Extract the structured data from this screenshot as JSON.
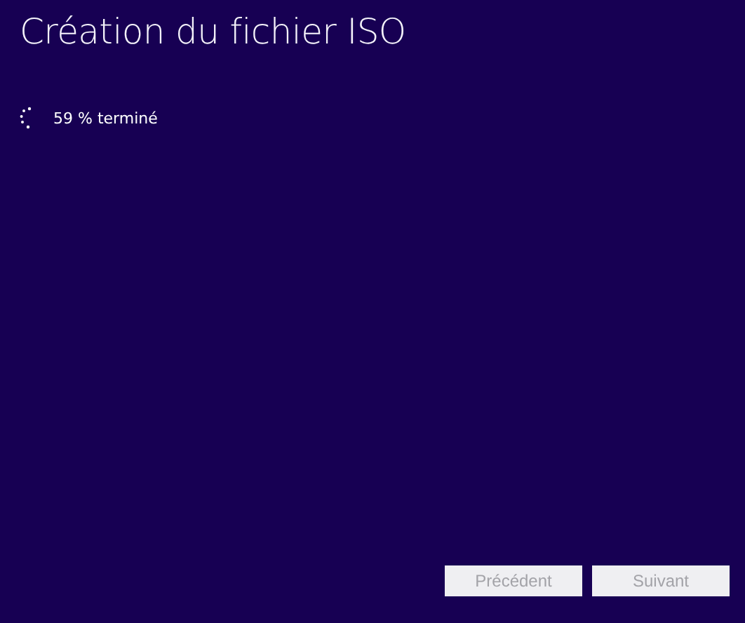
{
  "title": "Création du fichier ISO",
  "progress": {
    "text": "59 % terminé"
  },
  "buttons": [
    {
      "label": "Précédent",
      "disabled": true
    },
    {
      "label": "Suivant",
      "disabled": true
    }
  ]
}
